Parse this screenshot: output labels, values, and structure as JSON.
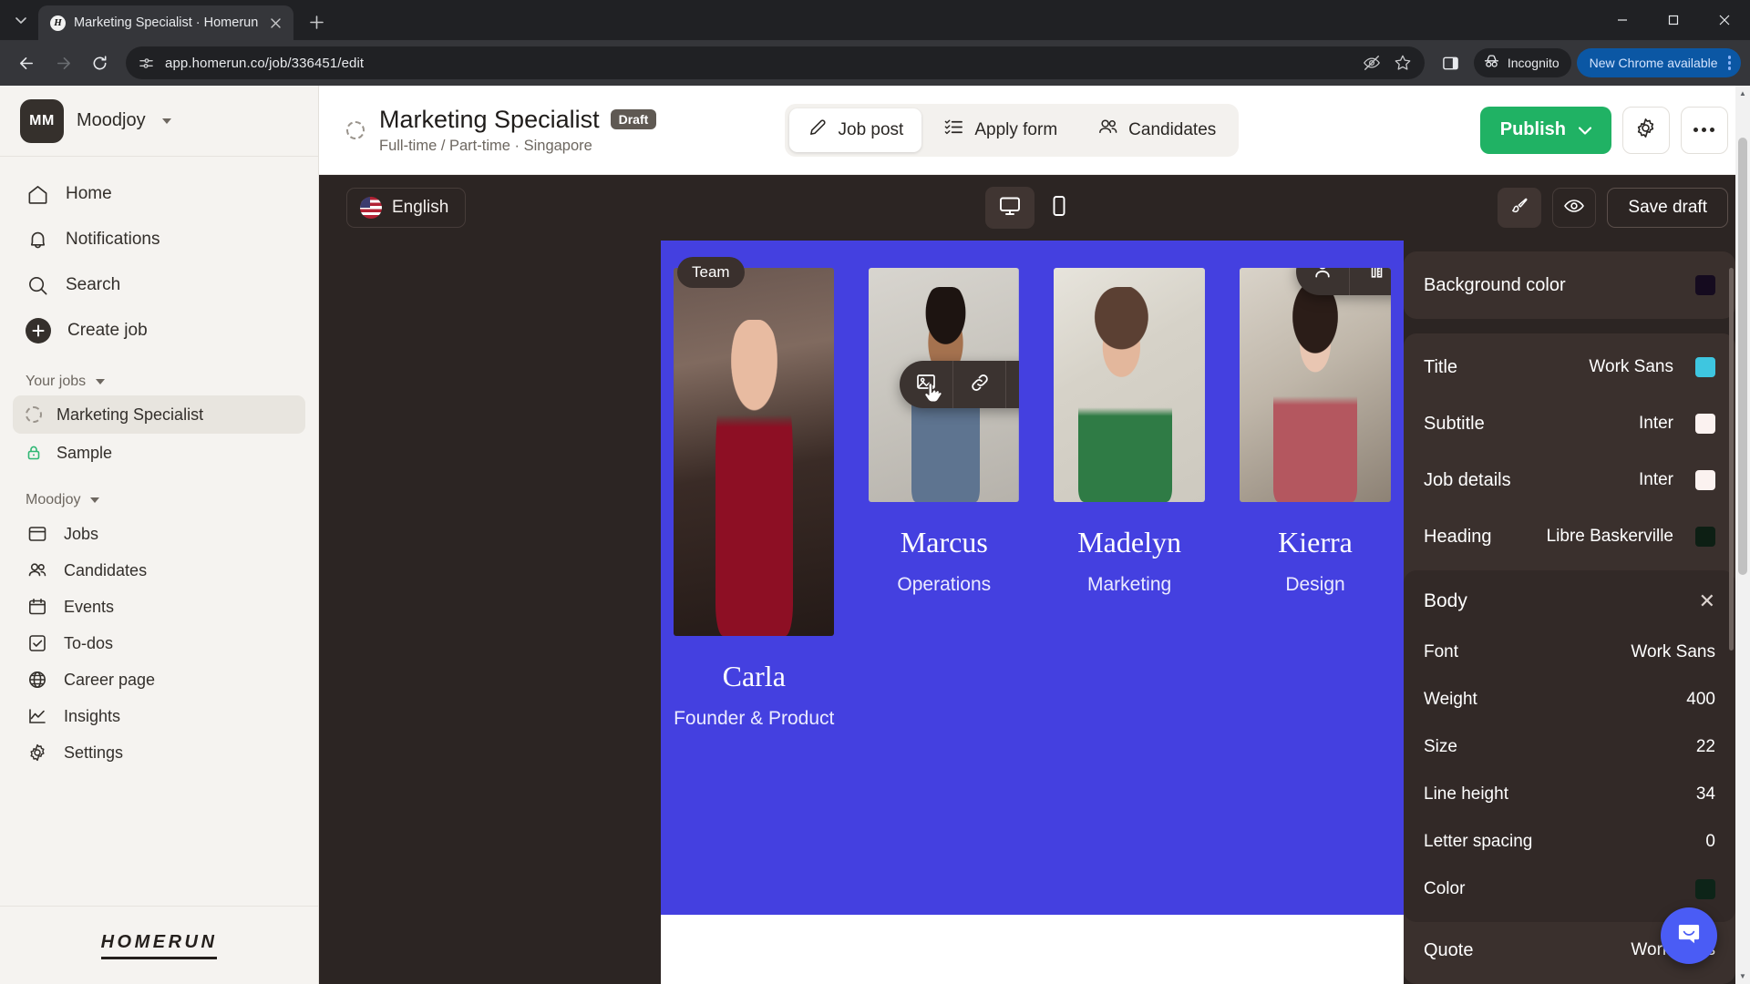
{
  "browser": {
    "tab": {
      "title": "Marketing Specialist · Homerun",
      "favicon_letter": "H",
      "favicon_name": "homerun-favicon"
    },
    "new_tab_label": "+",
    "tab_list_label": "⌄",
    "url": "app.homerun.co/job/336451/edit",
    "incognito_label": "Incognito",
    "update_label": "New Chrome available",
    "window_minimize": "—",
    "window_maximize": "▢",
    "window_close": "✕"
  },
  "sidebar": {
    "org": {
      "initials": "MM",
      "name": "Moodjoy"
    },
    "nav": [
      {
        "label": "Home",
        "icon": "home-icon"
      },
      {
        "label": "Notifications",
        "icon": "bell-icon"
      },
      {
        "label": "Search",
        "icon": "search-icon"
      },
      {
        "label": "Create job",
        "icon": "plus-icon"
      }
    ],
    "your_jobs_label": "Your jobs",
    "jobs": [
      {
        "label": "Marketing Specialist",
        "icon": "dotted-circle-icon",
        "active": true
      },
      {
        "label": "Sample",
        "icon": "lock-icon",
        "active": false
      }
    ],
    "workspace_label": "Moodjoy",
    "workspace_nav": [
      {
        "label": "Jobs",
        "icon": "browser-icon"
      },
      {
        "label": "Candidates",
        "icon": "people-icon"
      },
      {
        "label": "Events",
        "icon": "calendar-icon"
      },
      {
        "label": "To-dos",
        "icon": "checkbox-icon"
      },
      {
        "label": "Career page",
        "icon": "globe-icon"
      },
      {
        "label": "Insights",
        "icon": "chart-line-icon"
      },
      {
        "label": "Settings",
        "icon": "gear-icon"
      }
    ],
    "brand": "HOMERUN"
  },
  "header": {
    "job_title": "Marketing Specialist",
    "status_badge": "Draft",
    "job_subtitle": "Full-time / Part-time · Singapore",
    "tabs": [
      {
        "label": "Job post",
        "icon": "pencil-icon",
        "active": true
      },
      {
        "label": "Apply form",
        "icon": "form-list-icon",
        "active": false
      },
      {
        "label": "Candidates",
        "icon": "people-icon",
        "active": false
      }
    ],
    "publish_label": "Publish",
    "settings_icon": "gear-icon",
    "more_icon": "ellipsis-icon"
  },
  "editor_toolbar": {
    "language": "English",
    "language_flag": "us-flag-icon",
    "devices": [
      {
        "name": "desktop-view",
        "icon": "monitor-icon",
        "active": true
      },
      {
        "name": "mobile-view",
        "icon": "phone-icon",
        "active": false
      }
    ],
    "brush_icon": "paintbrush-icon",
    "preview_icon": "eye-icon",
    "save_draft_label": "Save draft"
  },
  "canvas": {
    "section_badge": "Team",
    "background_color": "#4440e0",
    "members": [
      {
        "name": "Carla",
        "role": "Founder & Product",
        "photo": "ph-carla"
      },
      {
        "name": "Marcus",
        "role": "Operations",
        "photo": "ph-marcus"
      },
      {
        "name": "Madelyn",
        "role": "Marketing",
        "photo": "ph-madelyn"
      },
      {
        "name": "Kierra",
        "role": "Design",
        "photo": "ph-kierra"
      }
    ],
    "image_toolbar": [
      {
        "name": "replace-image-button",
        "icon": "image-replace-icon"
      },
      {
        "name": "link-image-button",
        "icon": "link-icon"
      },
      {
        "name": "delete-image-button",
        "icon": "trash-icon"
      }
    ],
    "block_toolbar": [
      {
        "name": "person-block-button",
        "icon": "person-icon"
      },
      {
        "name": "style-block-button",
        "icon": "pen-ruler-icon",
        "badge": true
      },
      {
        "name": "block-more-button",
        "icon": "ellipsis-icon"
      }
    ]
  },
  "panel": {
    "background_color_label": "Background color",
    "background_color_value": "#150b1f",
    "typography": [
      {
        "label": "Title",
        "font": "Work Sans",
        "color": "#3ec6e0"
      },
      {
        "label": "Subtitle",
        "font": "Inter",
        "color": "#fbf2f0"
      },
      {
        "label": "Job details",
        "font": "Inter",
        "color": "#fbf2f0"
      },
      {
        "label": "Heading",
        "font": "Libre Baskerville",
        "color": "#0d1f14"
      }
    ],
    "body": {
      "title": "Body",
      "close_icon": "close-icon",
      "rows": [
        {
          "key": "Font",
          "value": "Work Sans"
        },
        {
          "key": "Weight",
          "value": "400"
        },
        {
          "key": "Size",
          "value": "22"
        },
        {
          "key": "Line height",
          "value": "34"
        },
        {
          "key": "Letter spacing",
          "value": "0"
        }
      ],
      "color_key": "Color",
      "color_value": "#0d2418"
    },
    "quote": {
      "label": "Quote",
      "font": "Work Sans"
    }
  },
  "intercom": {
    "icon": "chat-bubble-icon"
  }
}
